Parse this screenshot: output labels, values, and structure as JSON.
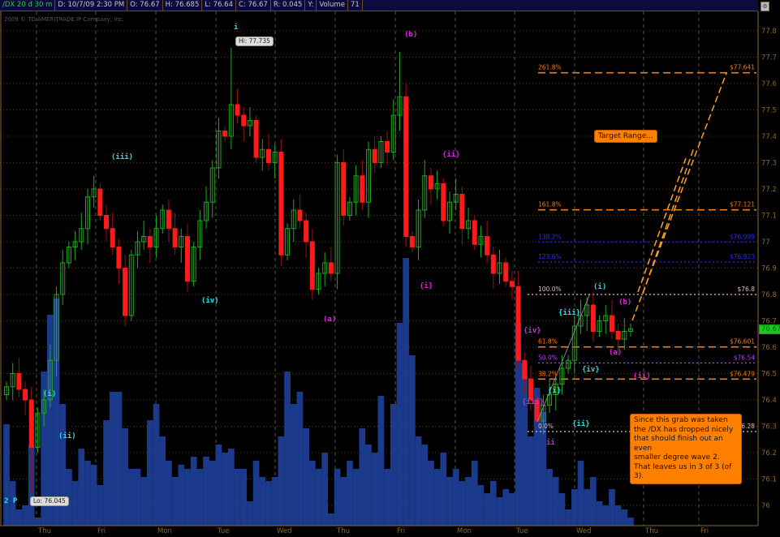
{
  "header": {
    "symbol": "/DX 20 d 30 m",
    "date": "D: 10/7/09 2:30 PM",
    "open": "O: 76.67",
    "high": "H: 76.685",
    "low": "L: 76.64",
    "close": "C: 76.67",
    "range": "R: 0.045",
    "y": "Y:",
    "volume_label": "Volume",
    "volume_value": "71",
    "copyright": "2009 © TD AMERITRADE IP Company, Inc."
  },
  "chart_data": {
    "type": "candlestick",
    "symbol": "/DX",
    "interval": "30 m",
    "ylim": [
      75.93,
      77.8
    ],
    "y_ticks": [
      "77.8",
      "77.7",
      "77.6",
      "77.5",
      "77.4",
      "77.3",
      "77.2",
      "77.1",
      "77",
      "76.9",
      "76.8",
      "76.7",
      "76.6",
      "76.5",
      "76.4",
      "76.3",
      "76.2",
      "76.1",
      "76"
    ],
    "x_ticks": [
      "Thu",
      "Fri",
      "Mon",
      "Tue",
      "Wed",
      "Thu",
      "Fri",
      "Mon",
      "Tue",
      "Wed",
      "Thu",
      "Fri"
    ],
    "first_open": 76.42,
    "closes": [
      76.45,
      76.5,
      76.44,
      76.4,
      76.22,
      76.35,
      76.4,
      76.55,
      76.8,
      76.92,
      76.98,
      77.0,
      77.05,
      77.17,
      77.2,
      77.1,
      77.05,
      76.98,
      76.9,
      76.72,
      76.95,
      77.0,
      77.02,
      76.98,
      77.05,
      77.12,
      77.05,
      76.98,
      77.02,
      76.85,
      76.98,
      77.08,
      77.15,
      77.28,
      77.42,
      77.4,
      77.52,
      77.48,
      77.44,
      77.46,
      77.32,
      77.35,
      77.3,
      77.34,
      76.95,
      77.05,
      77.12,
      77.08,
      77.0,
      76.82,
      76.88,
      76.92,
      76.88,
      77.3,
      77.1,
      77.15,
      77.25,
      77.15,
      77.35,
      77.3,
      77.38,
      77.34,
      77.48,
      77.55,
      77.02,
      76.98,
      77.12,
      77.25,
      77.2,
      77.22,
      77.08,
      77.15,
      77.18,
      77.05,
      77.08,
      76.99,
      77.02,
      76.95,
      76.88,
      76.92,
      76.85,
      76.83,
      76.55,
      76.48,
      76.4,
      76.32,
      76.38,
      76.42,
      76.46,
      76.52,
      76.55,
      76.68,
      76.72,
      76.76,
      76.66,
      76.7,
      76.72,
      76.66,
      76.63,
      76.66,
      76.67
    ],
    "extremes": [
      {
        "index": 4,
        "low": 76.045
      },
      {
        "index": 36,
        "high": 77.735
      },
      {
        "index": 63,
        "high": 77.72
      }
    ],
    "volume": [
      125,
      55,
      20,
      25,
      100,
      10,
      190,
      260,
      280,
      150,
      70,
      55,
      95,
      80,
      75,
      50,
      130,
      165,
      165,
      120,
      70,
      70,
      60,
      130,
      150,
      110,
      80,
      60,
      75,
      70,
      85,
      70,
      85,
      80,
      100,
      90,
      95,
      70,
      70,
      30,
      80,
      60,
      55,
      60,
      110,
      190,
      150,
      165,
      120,
      80,
      70,
      90,
      15,
      70,
      60,
      80,
      70,
      120,
      100,
      90,
      160,
      70,
      150,
      250,
      330,
      210,
      110,
      100,
      80,
      70,
      90,
      60,
      70,
      55,
      60,
      80,
      50,
      40,
      55,
      35,
      45,
      40,
      250,
      200,
      110,
      170,
      140,
      70,
      60,
      40,
      20,
      45,
      80,
      45,
      60,
      30,
      25,
      45,
      25,
      20,
      10
    ],
    "hi_tag": "Hi: 77.735",
    "lo_tag": "Lo: 76.045",
    "last_price": "76.67",
    "fib_levels": [
      {
        "pct": "261.8%",
        "price": "$77.641",
        "value": 77.641,
        "color": "#ff7a00",
        "style": "dash"
      },
      {
        "pct": "161.8%",
        "price": "$77.121",
        "value": 77.121,
        "color": "#ff7a00",
        "style": "dash"
      },
      {
        "pct": "138.2%",
        "price": "$76.999",
        "value": 76.999,
        "color": "#2a2aff",
        "style": "dot"
      },
      {
        "pct": "123.6%",
        "price": "$76.923",
        "value": 76.923,
        "color": "#2a2aff",
        "style": "dot"
      },
      {
        "pct": "100.0%",
        "price": "$76.8",
        "value": 76.8,
        "color": "#e8b8b8",
        "style": "dot"
      },
      {
        "pct": "61.8%",
        "price": "$76.601",
        "value": 76.601,
        "color": "#ff7a00",
        "style": "dash"
      },
      {
        "pct": "50.0%",
        "price": "$76.54",
        "value": 76.54,
        "color": "#b040ff",
        "style": "dot"
      },
      {
        "pct": "38.2%",
        "price": "$76.479",
        "value": 76.479,
        "color": "#ff7a00",
        "style": "dash"
      },
      {
        "pct": "0.0%",
        "price": "76.28",
        "value": 76.28,
        "color": "#e8b8b8",
        "style": "dot"
      }
    ],
    "wave_labels": [
      "i",
      "(iii)",
      "(iv)",
      "(i)",
      "(ii)",
      "2 P",
      "(b)",
      "{ii}",
      "{i}",
      "(a)",
      "{iv}",
      "{iii}",
      "ii",
      "(i)",
      "{iii}",
      "{iv}",
      "{i}",
      "{ii}",
      "(b)",
      "(a)",
      "(ii)"
    ],
    "callouts": {
      "target": "Target Range...",
      "note": [
        "Since this grab was taken",
        "the /DX has dropped nicely",
        "that should finish out an even",
        "smaller degree wave 2.",
        "That leaves us in 3 of 3 (of 3)."
      ]
    },
    "colors": {
      "up": "#1fa81f",
      "down": "#ff1a1a",
      "volume": "#1c3a8c",
      "axis": "#8a6a30",
      "cyan": "#22e0e8",
      "magenta": "#e020e0"
    }
  }
}
